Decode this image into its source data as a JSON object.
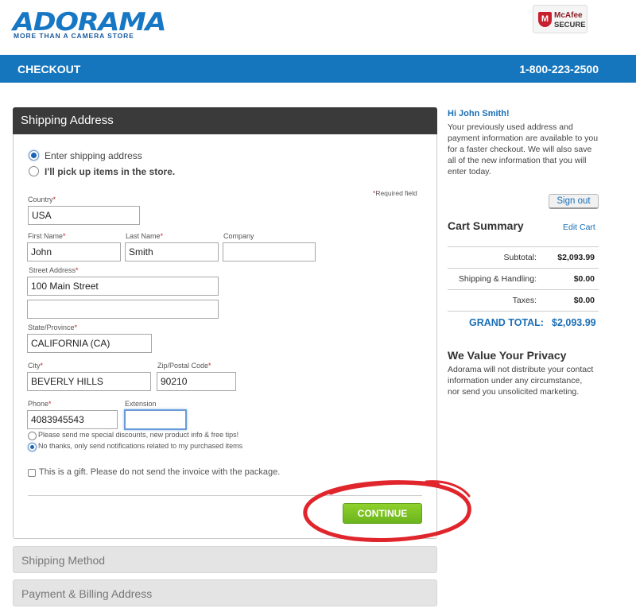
{
  "brand": {
    "logo_text": "ADORAMA",
    "tagline": "MORE THAN A CAMERA STORE",
    "badge_brand": "McAfee",
    "badge_secure": "SECURE",
    "accent_color": "#1576bd"
  },
  "header": {
    "title": "CHECKOUT",
    "phone": "1-800-223-2500"
  },
  "shipping": {
    "section_title": "Shipping Address",
    "option_ship": "Enter shipping address",
    "option_pickup": "I'll pick up items in the store.",
    "required_note": "Required field",
    "required_mark": "*",
    "fields": {
      "country": {
        "label": "Country",
        "value": "USA"
      },
      "first_name": {
        "label": "First Name",
        "value": "John"
      },
      "last_name": {
        "label": "Last Name",
        "value": "Smith"
      },
      "company": {
        "label": "Company",
        "value": ""
      },
      "street": {
        "label": "Street Address",
        "value": "100 Main Street"
      },
      "street2": {
        "value": ""
      },
      "state": {
        "label": "State/Province",
        "value": "CALIFORNIA (CA)"
      },
      "city": {
        "label": "City",
        "value": "BEVERLY HILLS"
      },
      "zip": {
        "label": "Zip/Postal Code",
        "value": "90210"
      },
      "phone": {
        "label": "Phone",
        "value": "4083945543"
      },
      "extension": {
        "label": "Extension",
        "value": ""
      }
    },
    "promo_opt_in": "Please send me special discounts, new product info & free tips!",
    "promo_opt_out": "No thanks, only send notifications related to my purchased items",
    "gift_label": "This is a gift. Please do not send the invoice with the package.",
    "continue_label": "CONTINUE"
  },
  "collapsed_sections": [
    "Shipping Method",
    "Payment & Billing Address"
  ],
  "sidebar": {
    "greeting": "Hi John Smith!",
    "message_lines": [
      "Your previously used address and",
      "payment information are available to you",
      "for a faster checkout. We will also save",
      "all of the new information that you will",
      "enter today."
    ],
    "signout_label": "Sign out",
    "cart_title": "Cart Summary",
    "edit_cart_label": "Edit Cart",
    "summary": [
      {
        "label": "Subtotal:",
        "value": "$2,093.99"
      },
      {
        "label": "Shipping & Handling:",
        "value": "$0.00"
      },
      {
        "label": "Taxes:",
        "value": "$0.00"
      }
    ],
    "grand_total_label": "GRAND TOTAL:",
    "grand_total_value": "$2,093.99",
    "privacy_title": "We Value Your Privacy",
    "privacy_lines": [
      "Adorama will not distribute your contact",
      "information under any circumstance,",
      "nor send you unsolicited marketing."
    ]
  }
}
